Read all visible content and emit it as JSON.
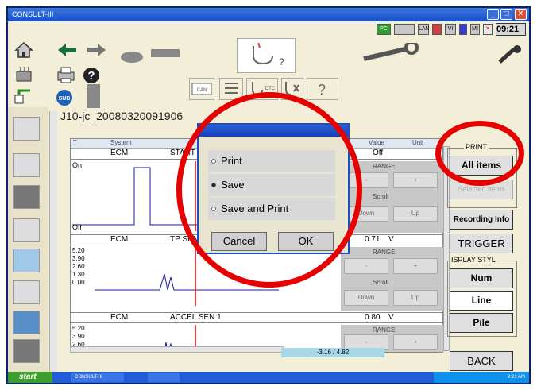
{
  "window": {
    "title": "CONSULT-III"
  },
  "status": {
    "pc": "PC",
    "lan": "LAN",
    "vi": "VI",
    "mi": "MI",
    "clock": "09:21"
  },
  "filename": "J10-jc_20080320091906",
  "grid": {
    "headers": {
      "t": "T",
      "system": "System",
      "value": "Value",
      "unit": "Unit"
    },
    "ch1": {
      "system": "ECM",
      "item": "START",
      "value": "Off",
      "on": "On",
      "off": "Off"
    },
    "ch2": {
      "system": "ECM",
      "item": "TP SEN",
      "value": "0.71",
      "unit": "V",
      "ticks": [
        "5.20",
        "3.90",
        "2.60",
        "1.30",
        "0.00"
      ]
    },
    "ch3": {
      "system": "ECM",
      "item": "ACCEL SEN 1",
      "value": "0.80",
      "unit": "V",
      "ticks": [
        "5.20",
        "3.90",
        "2.60"
      ]
    },
    "range_label": "RANGE",
    "scroll_label": "Scroll",
    "minus": "-",
    "plus": "+",
    "up": "Up",
    "down": "Down",
    "cursor_readout": "-3.16 / 4.82"
  },
  "right": {
    "print_group": "PRINT",
    "all_items": "All items",
    "selected_items": "Selected items",
    "recording_info": "Recording Info",
    "trigger": "TRIGGER",
    "display_style_group": "ISPLAY STYL",
    "num": "Num",
    "line": "Line",
    "pile": "Pile",
    "back": "BACK"
  },
  "dialog": {
    "options": [
      "Print",
      "Save",
      "Save and Print"
    ],
    "selected": "Save",
    "cancel": "Cancel",
    "ok": "OK"
  },
  "taskbar": {
    "start": "start",
    "app": "CONSULT-III",
    "time": "9:21 AM"
  },
  "colors": {
    "highlight_ring": "#e60000",
    "title_blue": "#1850c8",
    "panel_bg": "#f2eed8"
  }
}
